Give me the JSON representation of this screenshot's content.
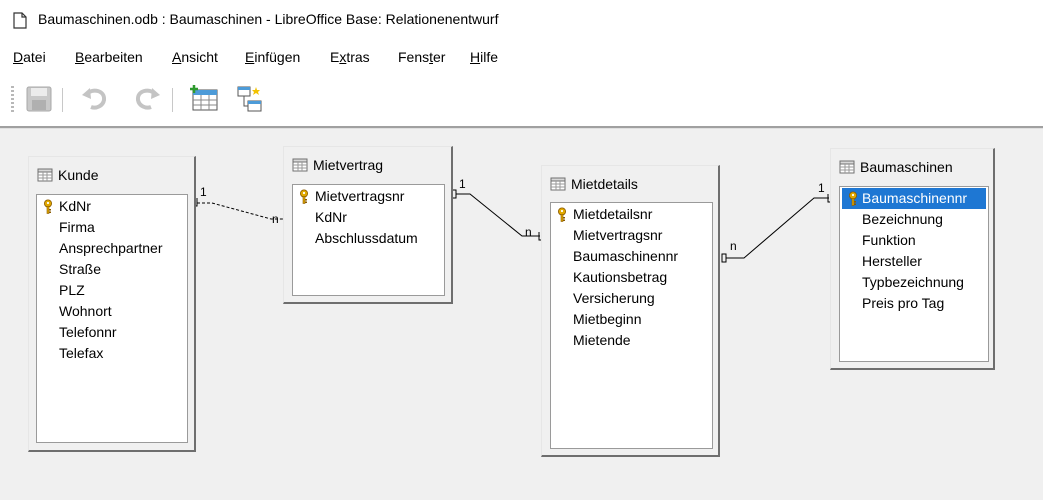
{
  "window": {
    "title": "Baumaschinen.odb : Baumaschinen - LibreOffice Base: Relationenentwurf"
  },
  "menu": [
    {
      "label": "Datei",
      "mnemonic_index": 0
    },
    {
      "label": "Bearbeiten",
      "mnemonic_index": 0
    },
    {
      "label": "Ansicht",
      "mnemonic_index": 0
    },
    {
      "label": "Einfügen",
      "mnemonic_index": 0
    },
    {
      "label": "Extras",
      "mnemonic_index": 1
    },
    {
      "label": "Fenster",
      "mnemonic_index": 4
    },
    {
      "label": "Hilfe",
      "mnemonic_index": 0
    }
  ],
  "toolbar": {
    "buttons": [
      "save-icon",
      "undo-icon",
      "redo-icon",
      "add-table-icon",
      "new-relation-icon"
    ]
  },
  "tables": {
    "kunde": {
      "name": "Kunde",
      "fields": [
        "KdNr",
        "Firma",
        "Ansprechpartner",
        "Straße",
        "PLZ",
        "Wohnort",
        "Telefonnr",
        "Telefax"
      ],
      "key_fields": [
        "KdNr"
      ]
    },
    "mietvertrag": {
      "name": "Mietvertrag",
      "fields": [
        "Mietvertragsnr",
        "KdNr",
        "Abschlussdatum"
      ],
      "key_fields": [
        "Mietvertragsnr"
      ]
    },
    "mietdetails": {
      "name": "Mietdetails",
      "fields": [
        "Mietdetailsnr",
        "Mietvertragsnr",
        "Baumaschinennr",
        "Kautionsbetrag",
        "Versicherung",
        "Mietbeginn",
        "Mietende"
      ],
      "key_fields": [
        "Mietdetailsnr"
      ]
    },
    "baumaschinen": {
      "name": "Baumaschinen",
      "fields": [
        "Baumaschinennr",
        "Bezeichnung",
        "Funktion",
        "Hersteller",
        "Typbezeichnung",
        "Preis pro Tag"
      ],
      "key_fields": [
        "Baumaschinennr"
      ],
      "selected_field": "Baumaschinennr"
    }
  },
  "relations": [
    {
      "from": "Kunde.KdNr",
      "to": "Mietvertrag.KdNr",
      "card_from": "1",
      "card_to": "n"
    },
    {
      "from": "Mietvertrag.Mietvertragsnr",
      "to": "Mietdetails.Mietvertragsnr",
      "card_from": "1",
      "card_to": "n"
    },
    {
      "from": "Baumaschinen.Baumaschinennr",
      "to": "Mietdetails.Baumaschinennr",
      "card_from": "1",
      "card_to": "n"
    }
  ],
  "colors": {
    "selection": "#1e77d3",
    "canvas": "#f0f0f0",
    "key": "#e0a800"
  }
}
